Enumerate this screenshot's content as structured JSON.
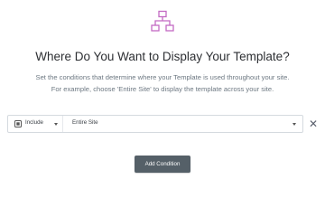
{
  "header": {
    "icon": "sitemap-icon",
    "title": "Where Do You Want to Display Your Template?",
    "description_line1": "Set the conditions that determine where your Template is used throughout your site.",
    "description_line2": "For example, choose 'Entire Site' to display the template across your site."
  },
  "condition": {
    "type_value": "Include",
    "type_icon": "include-icon",
    "scope_value": "Entire Site",
    "remove_icon": "close-icon",
    "remove_glyph": "✕"
  },
  "actions": {
    "add_label": "Add Condition"
  },
  "colors": {
    "icon_accent": "#c36ac3",
    "button_bg": "#556068"
  }
}
